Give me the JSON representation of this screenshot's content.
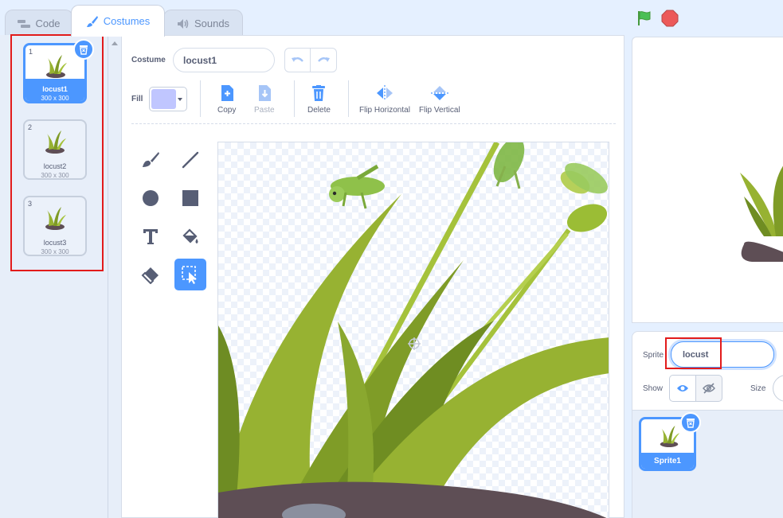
{
  "tabs": [
    {
      "label": "Code",
      "icon": "code-blocks-icon"
    },
    {
      "label": "Costumes",
      "icon": "paintbrush-icon",
      "active": true
    },
    {
      "label": "Sounds",
      "icon": "speaker-icon"
    }
  ],
  "controls": {
    "go": "green-flag-icon",
    "stop": "stop-sign-icon"
  },
  "costumes": [
    {
      "number": "1",
      "name": "locust1",
      "size": "300 x 300",
      "selected": true
    },
    {
      "number": "2",
      "name": "locust2",
      "size": "300 x 300"
    },
    {
      "number": "3",
      "name": "locust3",
      "size": "300 x 300"
    }
  ],
  "editor": {
    "costume_label": "Costume",
    "costume_name": "locust1",
    "fill_label": "Fill",
    "fill_color": "#c0c6ff",
    "actions": {
      "copy": "Copy",
      "paste": "Paste",
      "delete": "Delete",
      "flip_horizontal": "Flip Horizontal",
      "flip_vertical": "Flip Vertical"
    }
  },
  "sprite_info": {
    "sprite_label": "Sprite",
    "sprite_name": "locust",
    "show_label": "Show",
    "size_label": "Size"
  },
  "sprites": [
    {
      "name": "Sprite1",
      "selected": true
    }
  ],
  "colors": {
    "accent": "#4c97ff",
    "highlight": "#e21b1b",
    "plant": "#97b232",
    "rock": "#5e4e55"
  }
}
